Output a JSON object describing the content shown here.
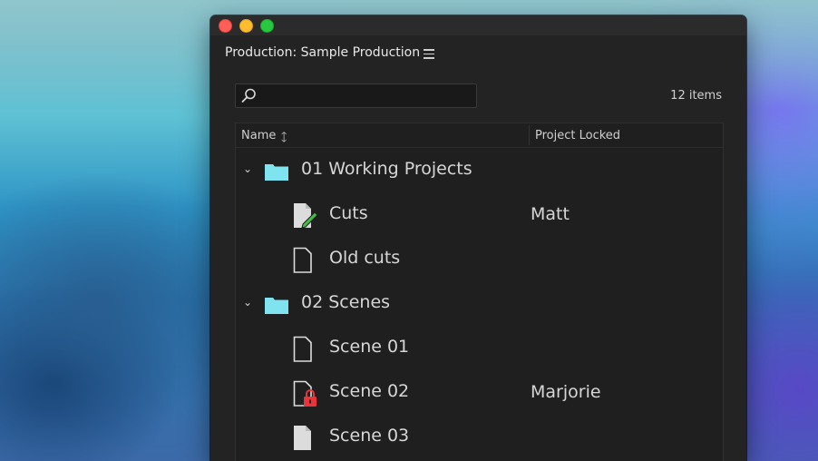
{
  "window": {
    "panel_title": "Production: Sample Production",
    "search_placeholder": "",
    "item_count": "12 items"
  },
  "list": {
    "columns": {
      "name": "Name",
      "locked": "Project Locked",
      "sort": "ascending"
    },
    "rows": [
      {
        "type": "folder",
        "label": "01 Working Projects",
        "locked_by": "",
        "expanded": true
      },
      {
        "type": "file-edit",
        "label": "Cuts",
        "locked_by": "Matt"
      },
      {
        "type": "file",
        "label": "Old cuts",
        "locked_by": ""
      },
      {
        "type": "folder",
        "label": "02 Scenes",
        "locked_by": "",
        "expanded": true
      },
      {
        "type": "file",
        "label": "Scene 01",
        "locked_by": ""
      },
      {
        "type": "file-locked",
        "label": "Scene 02",
        "locked_by": "Marjorie"
      },
      {
        "type": "file-filled",
        "label": "Scene 03",
        "locked_by": ""
      }
    ]
  },
  "colors": {
    "folder": "#7fe3f0",
    "edit_pencil": "#3fbf3f",
    "lock": "#e8343a",
    "window_bg": "#232323"
  }
}
